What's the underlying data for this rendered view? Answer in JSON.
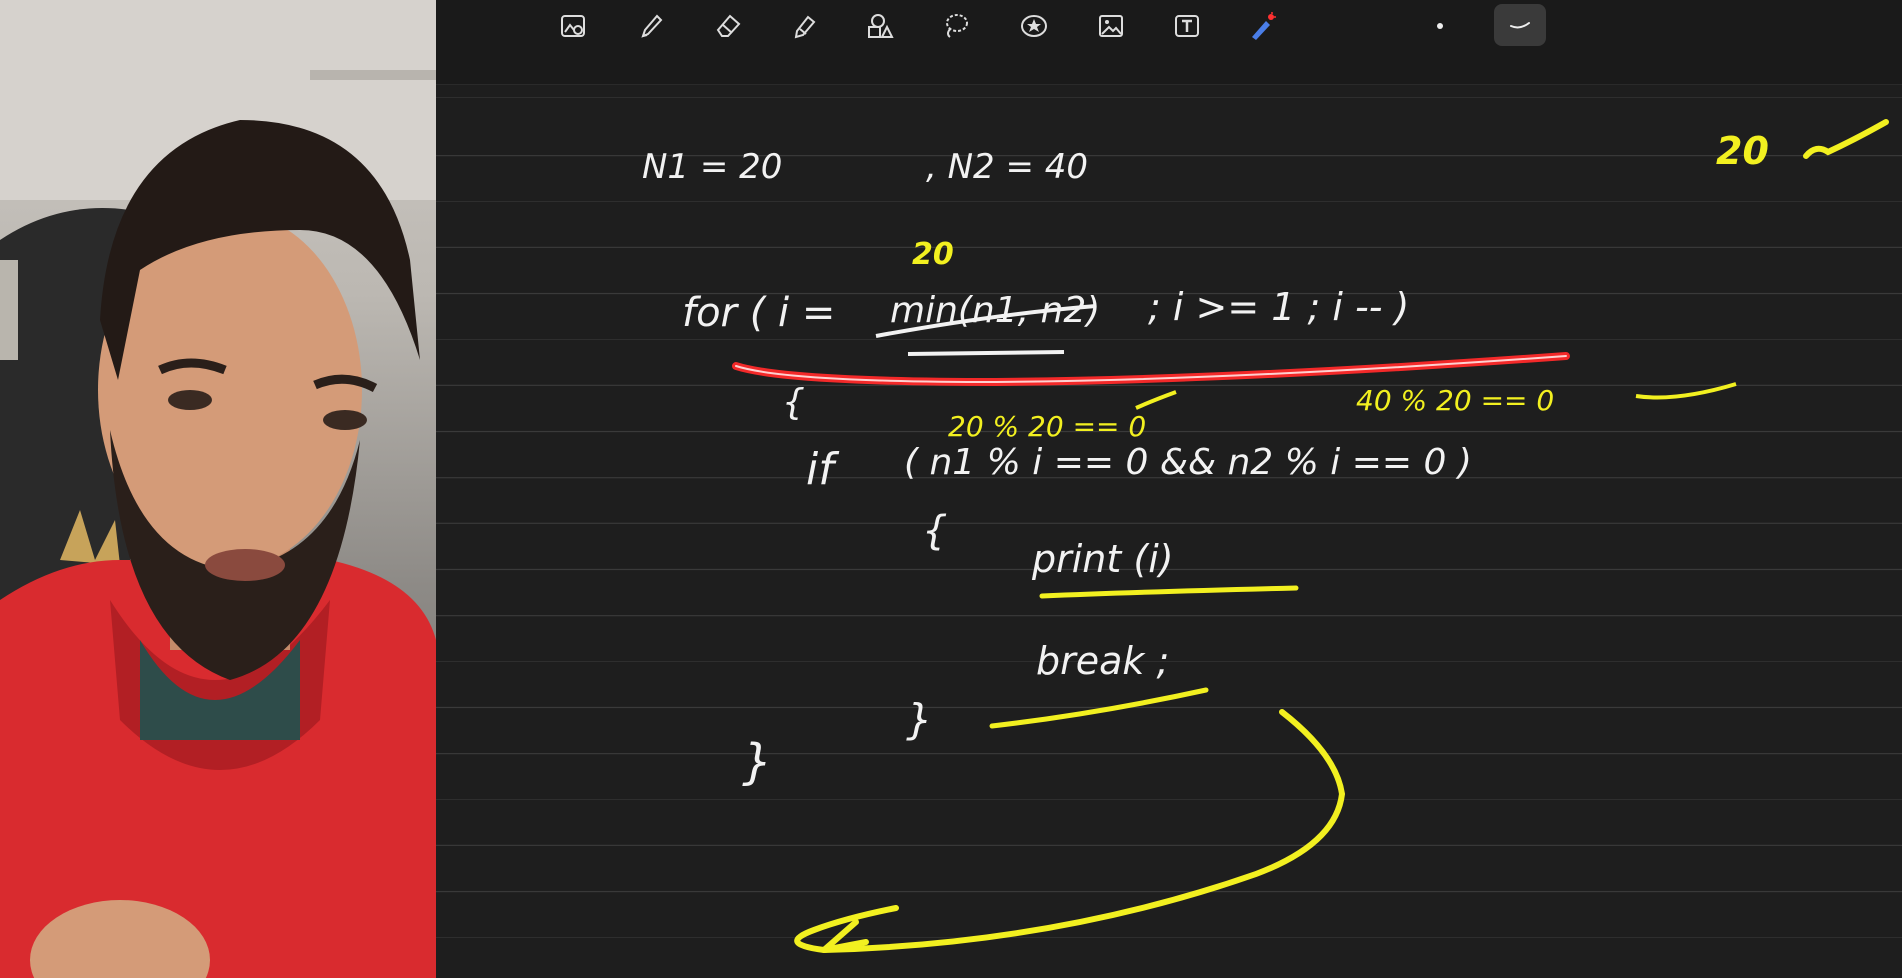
{
  "toolbar": {
    "tools": [
      {
        "name": "image-insert-icon"
      },
      {
        "name": "pen-icon"
      },
      {
        "name": "eraser-icon"
      },
      {
        "name": "highlighter-icon"
      },
      {
        "name": "shapes-icon"
      },
      {
        "name": "lasso-icon"
      },
      {
        "name": "sticker-icon"
      },
      {
        "name": "photo-icon"
      },
      {
        "name": "text-box-icon"
      },
      {
        "name": "laser-pointer-icon"
      },
      {
        "name": "stroke-dot-icon"
      },
      {
        "name": "stroke-line-icon"
      }
    ]
  },
  "notes": {
    "line1_n1": "N1 = 20",
    "line1_n2": ", N2 = 40",
    "corner_value": "20",
    "annot_min": "20",
    "for_head": "for ( i =",
    "for_min": "min(n1, n2)",
    "for_rest": "; i >= 1 ; i -- )",
    "brace_open1": "{",
    "annot_left": "20 % 20 == 0",
    "annot_right": "40 % 20 == 0",
    "if_kw": "if",
    "if_cond": "( n1 % i == 0  &&  n2 % i == 0 )",
    "brace_open2": "{",
    "print_stmt": "print (i)",
    "break_stmt": "break ;",
    "brace_close2": "}",
    "brace_close1": "}"
  },
  "colors": {
    "ink_white": "#f2f2f2",
    "ink_yellow": "#f2f020",
    "laser_red": "#ff2a2a",
    "hoodie": "#d92b2f"
  }
}
